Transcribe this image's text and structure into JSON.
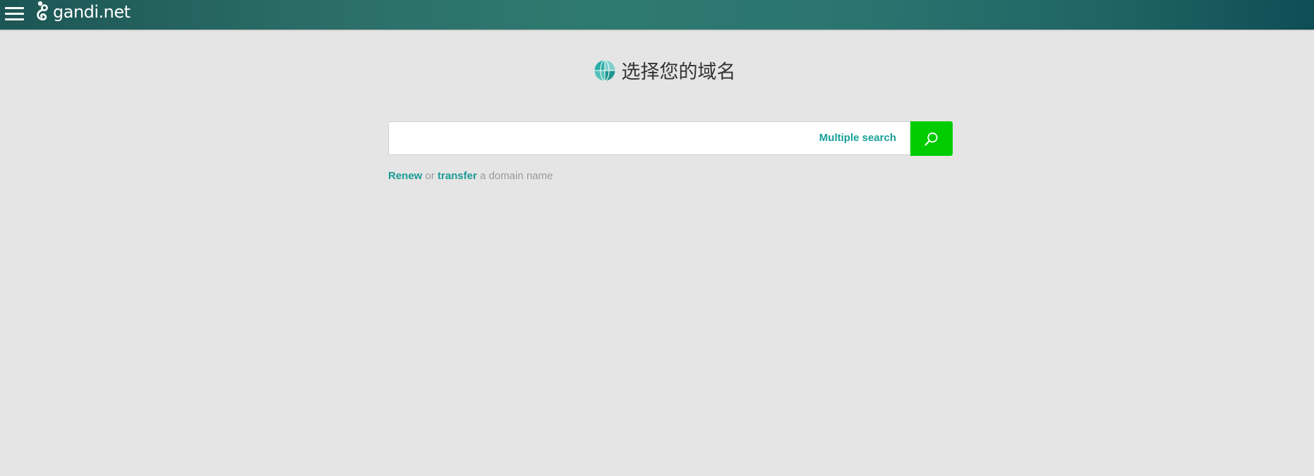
{
  "header": {
    "logo_text": "gandi.net",
    "menu_icon": "hamburger-menu-icon",
    "logo_icon": "gandi-logo-icon"
  },
  "main": {
    "title": "选择您的域名",
    "title_icon": "globe-icon"
  },
  "search": {
    "value": "",
    "placeholder": "",
    "multiple_search_label": "Multiple search",
    "button_icon": "search-icon"
  },
  "helper": {
    "renew_label": "Renew",
    "or_text": "or",
    "transfer_label": "transfer",
    "suffix_text": "a domain name"
  },
  "colors": {
    "header_gradient_start": "#1c5654",
    "header_gradient_end": "#0e4d55",
    "accent_teal": "#1aa19a",
    "search_button_green": "#00cc00",
    "background": "#e5e5e5"
  }
}
